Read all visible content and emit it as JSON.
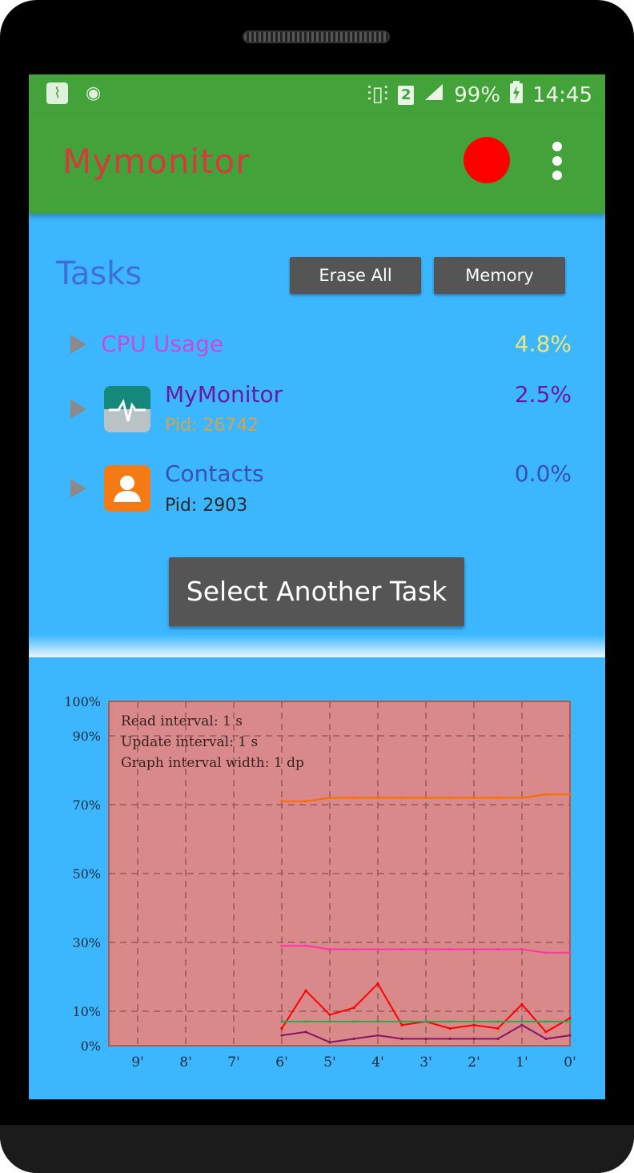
{
  "status_bar": {
    "battery_level": "99%",
    "time": "14:45",
    "sim_slot": "2",
    "icons": [
      "app-monitor-icon",
      "debug-icon",
      "vibrate-icon",
      "sim-icon",
      "signal-icon",
      "battery-charging-icon"
    ]
  },
  "appbar": {
    "title": "Mymonitor",
    "record_color": "#ff0000"
  },
  "tasks": {
    "title": "Tasks",
    "erase_all_label": "Erase All",
    "memory_label": "Memory",
    "cpu_usage_label": "CPU Usage",
    "cpu_usage_value": "4.8%",
    "items": [
      {
        "name": "MyMonitor",
        "pid": "Pid: 26742",
        "percent": "2.5%"
      },
      {
        "name": "Contacts",
        "pid": "Pid: 2903",
        "percent": "0.0%"
      }
    ],
    "select_button_label": "Select Another Task"
  },
  "graph": {
    "info_lines": [
      "Read interval: 1 s",
      "Update interval: 1 s",
      "Graph interval width: 1 dp"
    ],
    "y_tick_labels": [
      "100%",
      "90%",
      "70%",
      "50%",
      "30%",
      "10%",
      "0%"
    ],
    "x_tick_labels": [
      "9'",
      "8'",
      "7'",
      "6'",
      "5'",
      "4'",
      "3'",
      "2'",
      "1'",
      "0'"
    ],
    "background_color": "#d98989",
    "colors": {
      "total": "#ff6a00",
      "cpu": "#ff0000",
      "memory": "#ff33aa",
      "app": "#8a1466",
      "baseline": "#2ea84a"
    }
  },
  "chart_data": {
    "type": "line",
    "title": "",
    "xlabel": "",
    "ylabel": "",
    "ylim": [
      0,
      100
    ],
    "x_unit": "minutes ago",
    "x": [
      6.0,
      5.5,
      5.0,
      4.5,
      4.0,
      3.5,
      3.0,
      2.5,
      2.0,
      1.5,
      1.0,
      0.5,
      0.0
    ],
    "series": [
      {
        "name": "",
        "color": "#ff6a00",
        "values": [
          71,
          71,
          72,
          72,
          72,
          72,
          72,
          72,
          72,
          72,
          72,
          73,
          73
        ]
      },
      {
        "name": "",
        "color": "#ff33aa",
        "values": [
          29,
          29,
          28,
          28,
          28,
          28,
          28,
          28,
          28,
          28,
          28,
          27,
          27
        ]
      },
      {
        "name": "",
        "color": "#ff0000",
        "values": [
          5,
          16,
          9,
          11,
          18,
          6,
          7,
          5,
          6,
          5,
          12,
          4,
          8
        ]
      },
      {
        "name": "",
        "color": "#2ea84a",
        "values": [
          7,
          7,
          7,
          7,
          7,
          7,
          7,
          7,
          7,
          7,
          7,
          7,
          7
        ]
      },
      {
        "name": "",
        "color": "#8a1466",
        "values": [
          3,
          4,
          1,
          2,
          3,
          2,
          2,
          2,
          2,
          2,
          6,
          2,
          3
        ]
      }
    ],
    "grid": true
  }
}
